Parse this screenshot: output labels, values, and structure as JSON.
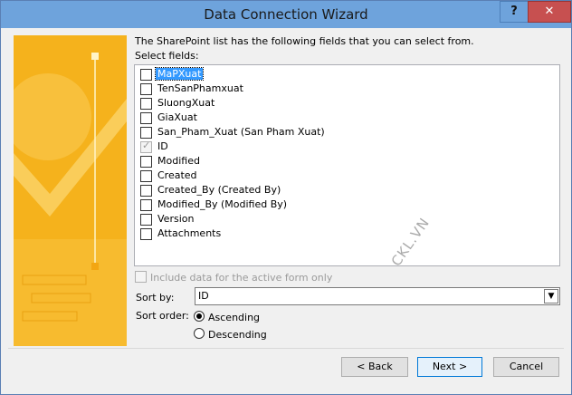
{
  "window": {
    "title": "Data Connection Wizard",
    "help_label": "?",
    "close_label": "✕"
  },
  "intro": "The SharePoint list has the following fields that you can select from.",
  "select_fields_label": "Select fields:",
  "fields": [
    {
      "label": "MaPXuat",
      "checked": false,
      "disabled": false,
      "selected": true
    },
    {
      "label": "TenSanPhamxuat",
      "checked": false,
      "disabled": false,
      "selected": false
    },
    {
      "label": "SluongXuat",
      "checked": false,
      "disabled": false,
      "selected": false
    },
    {
      "label": "GiaXuat",
      "checked": false,
      "disabled": false,
      "selected": false
    },
    {
      "label": "San_Pham_Xuat (San Pham Xuat)",
      "checked": false,
      "disabled": false,
      "selected": false
    },
    {
      "label": "ID",
      "checked": true,
      "disabled": true,
      "selected": false
    },
    {
      "label": "Modified",
      "checked": false,
      "disabled": false,
      "selected": false
    },
    {
      "label": "Created",
      "checked": false,
      "disabled": false,
      "selected": false
    },
    {
      "label": "Created_By (Created By)",
      "checked": false,
      "disabled": false,
      "selected": false
    },
    {
      "label": "Modified_By (Modified By)",
      "checked": false,
      "disabled": false,
      "selected": false
    },
    {
      "label": "Version",
      "checked": false,
      "disabled": false,
      "selected": false
    },
    {
      "label": "Attachments",
      "checked": false,
      "disabled": false,
      "selected": false
    }
  ],
  "watermark": "CKL.VN",
  "include_label": "Include data for the active form only",
  "sort_by": {
    "label": "Sort by:",
    "value": "ID"
  },
  "sort_order": {
    "label": "Sort order:",
    "options": [
      "Ascending",
      "Descending"
    ],
    "selected": "Ascending"
  },
  "buttons": {
    "back": "< Back",
    "next": "Next >",
    "cancel": "Cancel"
  },
  "colors": {
    "sidebar": "#f5b21c",
    "titlebar": "#6ea3dc",
    "selection": "#3399ff"
  }
}
